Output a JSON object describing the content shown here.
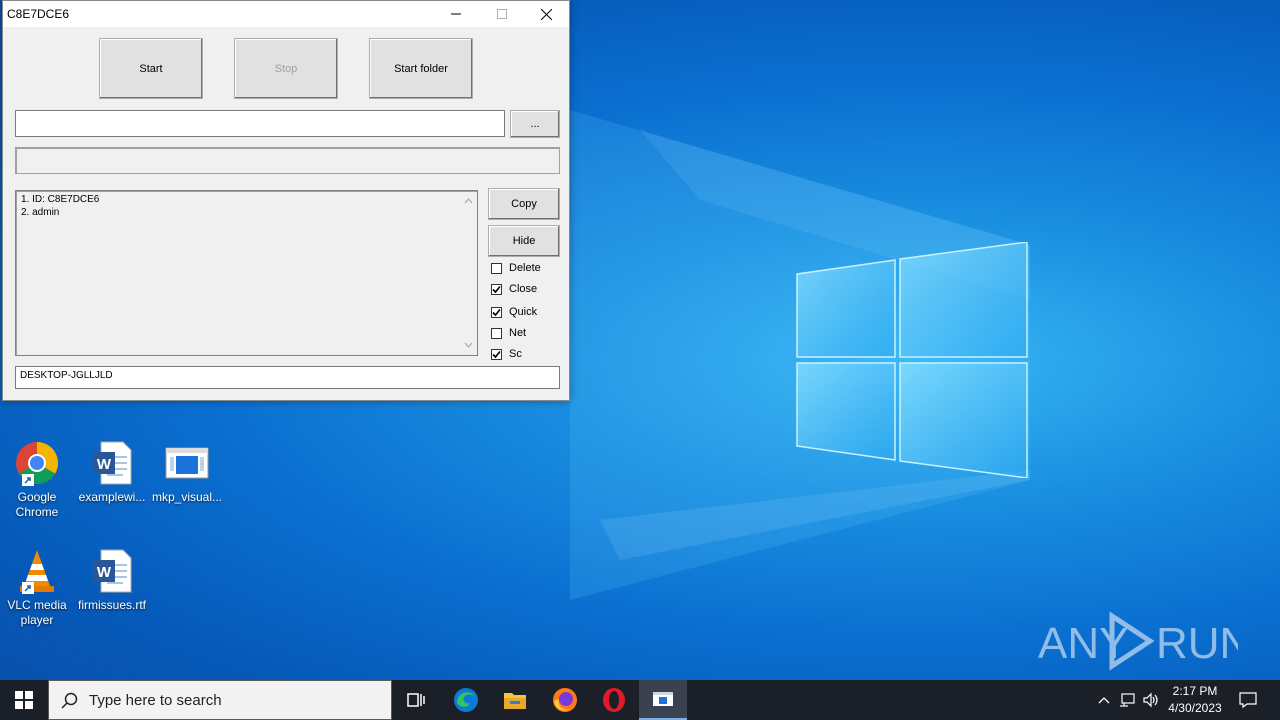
{
  "window": {
    "title": "C8E7DCE6",
    "buttons": {
      "start": "Start",
      "stop": "Stop",
      "start_folder": "Start folder",
      "browse": "...",
      "copy": "Copy",
      "hide": "Hide"
    },
    "path_value": "",
    "status_value": "",
    "log_lines": [
      "1. ID: C8E7DCE6",
      "2. admin"
    ],
    "options": [
      {
        "label": "Delete",
        "checked": false
      },
      {
        "label": "Close",
        "checked": true
      },
      {
        "label": "Quick",
        "checked": true
      },
      {
        "label": "Net",
        "checked": false
      },
      {
        "label": "Sc",
        "checked": true
      }
    ],
    "computer_name": "DESKTOP-JGLLJLD"
  },
  "desktop": {
    "icons": [
      {
        "name": "Google Chrome",
        "icon": "chrome-icon"
      },
      {
        "name": "examplewi...",
        "icon": "word-icon"
      },
      {
        "name": "mkp_visual...",
        "icon": "app-icon"
      },
      {
        "name": "VLC media player",
        "icon": "vlc-icon"
      },
      {
        "name": "firmissues.rtf",
        "icon": "word-icon"
      }
    ],
    "watermark": "ANY RUN"
  },
  "taskbar": {
    "search_placeholder": "Type here to search",
    "apps": [
      "task-view-icon",
      "edge-icon",
      "file-explorer-icon",
      "firefox-icon",
      "opera-icon",
      "app-window-icon"
    ],
    "clock_time": "2:17 PM",
    "clock_date": "4/30/2023"
  },
  "colors": {
    "desktop_blue": "#0a6fd0",
    "window_bg": "#f0f0f0",
    "taskbar": "#1b1f28"
  }
}
